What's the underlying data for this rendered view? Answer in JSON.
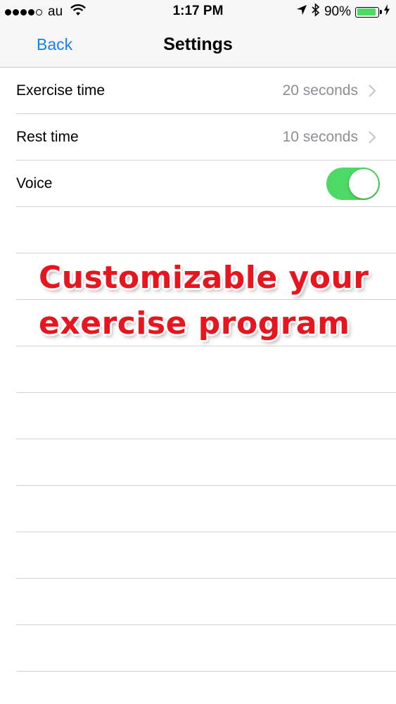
{
  "status_bar": {
    "signal_dots_filled": 4,
    "signal_dots_total": 5,
    "carrier": "au",
    "time": "1:17 PM",
    "battery_percent": "90%",
    "battery_level": 0.9,
    "icons": [
      "wifi-icon",
      "location-arrow-icon",
      "bluetooth-icon",
      "battery-icon",
      "charging-bolt-icon"
    ]
  },
  "nav": {
    "back_label": "Back",
    "title": "Settings"
  },
  "settings": {
    "exercise_time": {
      "label": "Exercise time",
      "value": "20 seconds"
    },
    "rest_time": {
      "label": "Rest time",
      "value": "10 seconds"
    },
    "voice": {
      "label": "Voice",
      "enabled": true
    }
  },
  "promo": {
    "line1": "Customizable your",
    "line2": "exercise program"
  },
  "colors": {
    "accent": "#1a7ef4",
    "toggle_on": "#4cd964",
    "promo_text": "#e8141e",
    "secondary_text": "#8e8e93"
  }
}
